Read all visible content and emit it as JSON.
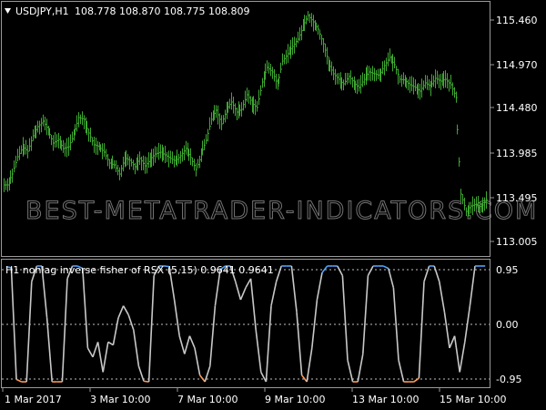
{
  "window": {
    "symbol_title": "USDJPY,H1",
    "ohlc": "108.778 108.870 108.775 108.809"
  },
  "watermark": "BEST-METATRADER-INDICATORS.COM",
  "indicator": {
    "title": "H1 nonlag inverse fisher of RSX (5,15) 0.9641 0.9641",
    "levels": [
      "0.95",
      "0.00",
      "-0.95"
    ],
    "colors": {
      "line": "#c8c8c8",
      "rising": "#4fa3ff",
      "falling": "#ff9955",
      "level": "#c0c0c0"
    }
  },
  "colors": {
    "background": "#000000",
    "bars": "#3fa832",
    "frame": "#9a9a9a",
    "text": "#ffffff"
  },
  "chart_data": [
    {
      "type": "line",
      "title": "USDJPY,H1",
      "ylim": [
        112.85,
        115.62
      ],
      "y_ticks": [
        "115.460",
        "114.970",
        "114.480",
        "113.985",
        "113.495",
        "113.005"
      ],
      "x_ticks": [
        "1 Mar 2017",
        "3 Mar 10:00",
        "7 Mar 10:00",
        "9 Mar 10:00",
        "13 Mar 10:00",
        "15 Mar 10:00"
      ],
      "series": [
        {
          "values": [
            113.62,
            113.74,
            113.93,
            114.04,
            113.99,
            114.16,
            114.26,
            114.32,
            114.22,
            114.08,
            114.12,
            114.02,
            114.04,
            114.17,
            114.36,
            114.34,
            114.19,
            114.06,
            114.04,
            113.98,
            113.86,
            113.84,
            113.74,
            113.92,
            113.89,
            113.82,
            113.91,
            113.83,
            113.9,
            113.96,
            113.98,
            113.95,
            113.91,
            113.88,
            113.94,
            114.02,
            113.92,
            113.79,
            113.95,
            114.11,
            114.34,
            114.44,
            114.29,
            114.45,
            114.53,
            114.42,
            114.45,
            114.61,
            114.52,
            114.47,
            114.75,
            114.91,
            114.86,
            114.71,
            114.98,
            115.06,
            115.14,
            115.22,
            115.36,
            115.48,
            115.41,
            115.33,
            115.17,
            114.96,
            114.84,
            114.78,
            114.73,
            114.81,
            114.74,
            114.69,
            114.78,
            114.86,
            114.84,
            114.82,
            114.93,
            115.02,
            114.94,
            114.78,
            114.77,
            114.72,
            114.69,
            114.65,
            114.74,
            114.7,
            114.79,
            114.76,
            114.78,
            114.72,
            114.58,
            113.52,
            113.33,
            113.39,
            113.41,
            113.37,
            113.46
          ]
        }
      ]
    },
    {
      "type": "line",
      "title": "H1 nonlag inverse fisher of RSX (5,15) 0.9641 0.9641",
      "ylim": [
        -1.05,
        1.05
      ],
      "y_ticks": [
        "0.95",
        "0.00",
        "-0.95"
      ],
      "series": [
        {
          "values": [
            0.95,
            0.93,
            -0.92,
            -0.96,
            -0.96,
            0.7,
            0.96,
            0.96,
            0.1,
            -0.96,
            -0.96,
            -0.96,
            0.75,
            0.96,
            0.96,
            0.92,
            -0.4,
            -0.55,
            -0.3,
            -0.8,
            -0.3,
            -0.35,
            0.1,
            0.3,
            0.15,
            -0.1,
            -0.7,
            -0.95,
            -0.96,
            0.8,
            0.96,
            0.96,
            0.95,
            0.4,
            -0.2,
            -0.5,
            -0.2,
            -0.4,
            -0.85,
            -0.96,
            -0.7,
            0.3,
            0.9,
            0.96,
            0.96,
            0.7,
            0.4,
            0.6,
            0.75,
            -0.1,
            -0.8,
            -0.96,
            0.3,
            0.7,
            0.96,
            0.96,
            0.96,
            0.2,
            -0.85,
            -0.96,
            -0.4,
            0.4,
            0.85,
            0.96,
            0.96,
            0.96,
            0.8,
            -0.6,
            -0.96,
            -0.96,
            -0.5,
            0.8,
            0.96,
            0.96,
            0.96,
            0.92,
            0.6,
            -0.6,
            -0.96,
            -0.96,
            -0.96,
            -0.9,
            0.7,
            0.96,
            0.96,
            0.7,
            0.2,
            -0.4,
            -0.2,
            -0.8,
            -0.3,
            0.3,
            0.96,
            0.96,
            0.96
          ]
        }
      ]
    }
  ]
}
